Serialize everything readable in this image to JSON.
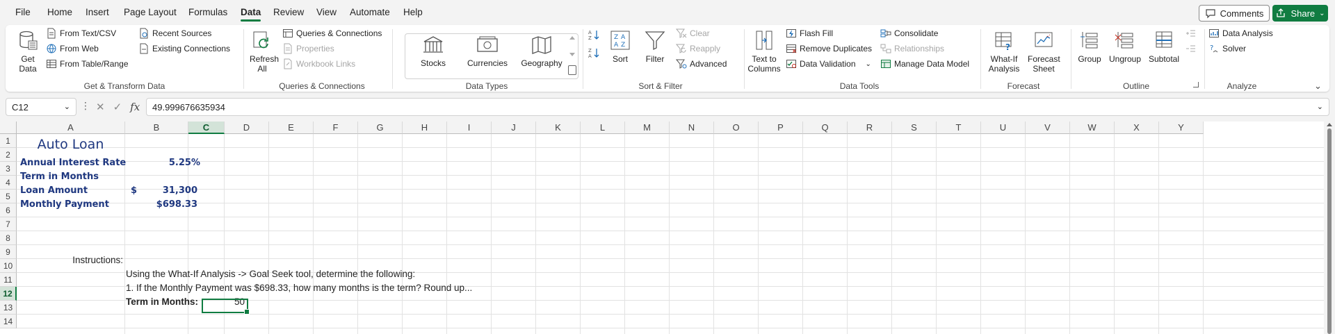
{
  "menu": {
    "tabs": [
      "File",
      "Home",
      "Insert",
      "Page Layout",
      "Formulas",
      "Data",
      "Review",
      "View",
      "Automate",
      "Help"
    ],
    "active": "Data",
    "comments_label": "Comments",
    "share_label": "Share"
  },
  "ribbon": {
    "get_transform": {
      "get_data": "Get Data",
      "from_text_csv": "From Text/CSV",
      "from_web": "From Web",
      "from_table_range": "From Table/Range",
      "recent_sources": "Recent Sources",
      "existing_connections": "Existing Connections",
      "label": "Get & Transform Data"
    },
    "queries": {
      "refresh_all": "Refresh All",
      "queries_connections": "Queries & Connections",
      "properties": "Properties",
      "workbook_links": "Workbook Links",
      "label": "Queries & Connections"
    },
    "data_types": {
      "stocks": "Stocks",
      "currencies": "Currencies",
      "geography": "Geography",
      "label": "Data Types"
    },
    "sort_filter": {
      "sort": "Sort",
      "filter": "Filter",
      "clear": "Clear",
      "reapply": "Reapply",
      "advanced": "Advanced",
      "label": "Sort & Filter"
    },
    "data_tools": {
      "text_to_columns": "Text to Columns",
      "flash_fill": "Flash Fill",
      "remove_duplicates": "Remove Duplicates",
      "data_validation": "Data Validation",
      "consolidate": "Consolidate",
      "relationships": "Relationships",
      "manage_data_model": "Manage Data Model",
      "label": "Data Tools"
    },
    "forecast": {
      "what_if": "What-If Analysis",
      "forecast_sheet": "Forecast Sheet",
      "label": "Forecast"
    },
    "outline": {
      "group": "Group",
      "ungroup": "Ungroup",
      "subtotal": "Subtotal",
      "label": "Outline"
    },
    "analyze": {
      "data_analysis": "Data Analysis",
      "solver": "Solver",
      "label": "Analyze"
    }
  },
  "formula_bar": {
    "name_box": "C12",
    "formula": "49.999676635934"
  },
  "sheet": {
    "columns": [
      "A",
      "B",
      "C",
      "D",
      "E",
      "F",
      "G",
      "H",
      "I",
      "J",
      "K",
      "L",
      "M",
      "N",
      "O",
      "P",
      "Q",
      "R",
      "S",
      "T",
      "U",
      "V",
      "W",
      "X",
      "Y"
    ],
    "selected_column": "C",
    "rows": [
      "1",
      "2",
      "3",
      "4",
      "5",
      "6",
      "7",
      "8",
      "9",
      "10",
      "11",
      "12",
      "13",
      "14"
    ],
    "selected_row": "12",
    "cells": {
      "A1": "Auto Loan",
      "A2": "Annual Interest Rate",
      "B2": "5.25%",
      "A3": "Term in Months",
      "A4": "Loan Amount",
      "B4_currency": "$",
      "B4": "31,300",
      "A5": "Monthly Payment",
      "B5": "$698.33",
      "A9": "Instructions:",
      "B10": "Using the What-If Analysis -> Goal Seek tool, determine the following:",
      "B11": "1. If the Monthly Payment was $698.33, how many months is the term? Round up...",
      "B12": "Term in Months:",
      "C12": "50"
    }
  },
  "colors": {
    "accent": "#107c41",
    "navy_text": "#1f3880"
  }
}
